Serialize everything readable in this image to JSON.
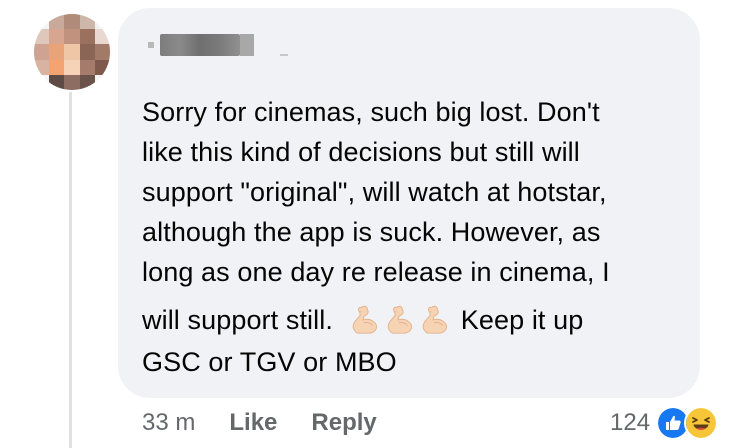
{
  "comment": {
    "author_name": "",
    "text_lines": [
      "Sorry for cinemas, such big lost. Don't",
      "like this kind of decisions but still will",
      "support \"original\", will watch at hotstar,",
      "although the app is suck. However, as",
      "long as one day re release in cinema, I"
    ],
    "text_emoji_line_before": "will support still.",
    "emoji": [
      "flexed-biceps",
      "flexed-biceps",
      "flexed-biceps"
    ],
    "text_emoji_line_after": "Keep it up",
    "text_last_line": "GSC or TGV or MBO"
  },
  "actions": {
    "timestamp": "33 m",
    "like_label": "Like",
    "reply_label": "Reply"
  },
  "reactions": {
    "count": "124",
    "types": [
      "like-icon",
      "haha-icon"
    ]
  },
  "colors": {
    "bubble": "#f0f2f5",
    "text": "#050505",
    "secondary_text": "#65676b",
    "like_blue": "#1877f2",
    "haha_yellow": "#f7c538"
  }
}
